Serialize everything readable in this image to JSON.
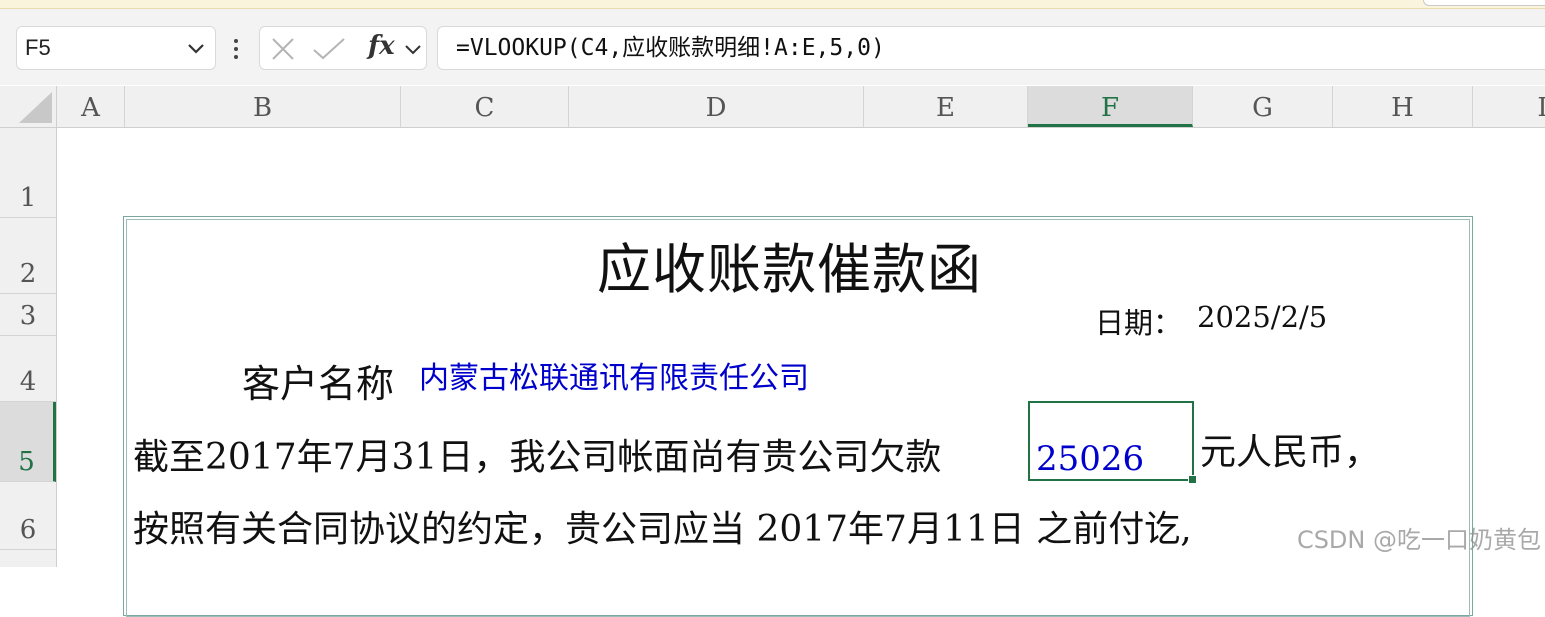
{
  "formula_bar": {
    "name_box": "F5",
    "fx_label": "fx",
    "formula": "=VLOOKUP(C4,应收账款明细!A:E,5,0)"
  },
  "columns": [
    "A",
    "B",
    "C",
    "D",
    "E",
    "F",
    "G",
    "H",
    "I"
  ],
  "selected_column": "F",
  "rows": [
    "1",
    "2",
    "3",
    "4",
    "5",
    "6"
  ],
  "selected_row": "5",
  "sheet": {
    "title": "应收账款催款函",
    "date_label": "日期：",
    "date_value": "2025/2/5",
    "customer_label": "客户名称",
    "customer_name": "内蒙古松联通讯有限责任公司",
    "line5_text": "截至2017年7月31日，我公司帐面尚有贵公司欠款",
    "active_cell_value": "25026",
    "line5_after": "元人民币，",
    "line6_text": "按照有关合同协议的约定，贵公司应当  2017年7月11日  之前付讫,"
  },
  "watermark": "CSDN @吃一口奶黄包",
  "colors": {
    "accent": "#217346",
    "value_blue": "#0000cc"
  }
}
